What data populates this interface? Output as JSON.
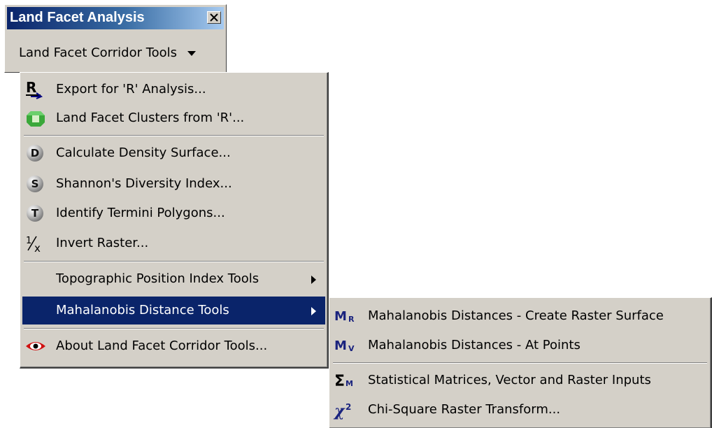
{
  "toolbar": {
    "title": "Land Facet Analysis",
    "dropdown_label": "Land Facet Corridor Tools"
  },
  "menu": {
    "items": [
      {
        "label": "Export for 'R' Analysis...",
        "icon": "r-export-icon"
      },
      {
        "label": "Land Facet Clusters from 'R'...",
        "icon": "green-cube-icon"
      },
      {
        "label": "Calculate Density Surface...",
        "icon": "d-ball-icon",
        "glyph": "D"
      },
      {
        "label": "Shannon's Diversity Index...",
        "icon": "s-ball-icon",
        "glyph": "S"
      },
      {
        "label": "Identify Termini Polygons...",
        "icon": "t-ball-icon",
        "glyph": "T"
      },
      {
        "label": "Invert Raster...",
        "icon": "invert-fraction-icon"
      },
      {
        "label": "Topographic Position Index Tools",
        "submenu": true
      },
      {
        "label": "Mahalanobis Distance Tools",
        "submenu": true,
        "selected": true
      },
      {
        "label": "About Land Facet Corridor Tools...",
        "icon": "red-eye-icon"
      }
    ]
  },
  "submenu": {
    "items": [
      {
        "label": "Mahalanobis Distances - Create Raster Surface",
        "icon": "mr-icon"
      },
      {
        "label": "Mahalanobis Distances - At Points",
        "icon": "mv-icon"
      },
      {
        "label": "Statistical Matrices, Vector and Raster Inputs",
        "icon": "sigma-m-icon"
      },
      {
        "label": "Chi-Square Raster Transform...",
        "icon": "chi-square-icon"
      }
    ]
  },
  "colors": {
    "face": "#d4d0c8",
    "highlight": "#0a246a",
    "title_gradient_end": "#a6caf0"
  }
}
